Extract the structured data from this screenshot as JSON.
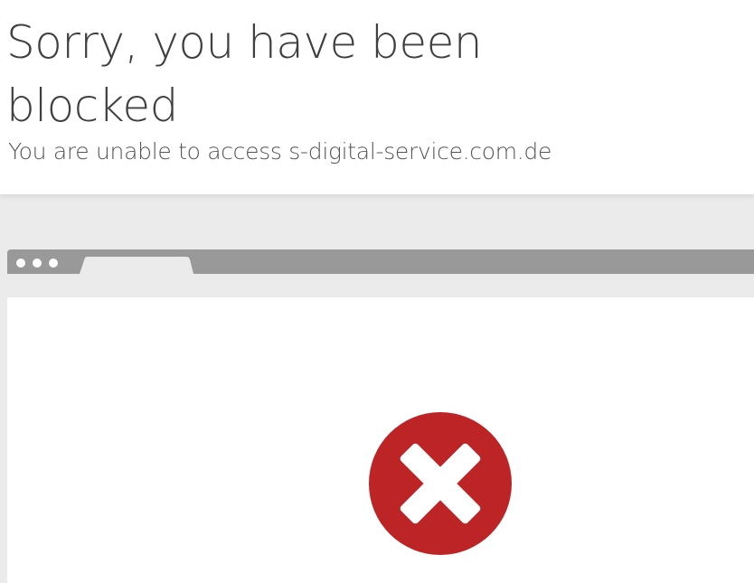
{
  "page": {
    "title": "Sorry, you have been blocked",
    "subtitle": "You are unable to access s-digital-service.com.de"
  },
  "browser_illustration": {
    "window_dots": [
      "dot",
      "dot",
      "dot"
    ],
    "tab": "tab-shape",
    "status_icon": "error-x-circle-icon"
  },
  "colors": {
    "title_text": "#404040",
    "subtitle_text": "#555555",
    "background_gray": "#ebebeb",
    "browser_bar": "#999999",
    "error_red": "#bd2426"
  }
}
